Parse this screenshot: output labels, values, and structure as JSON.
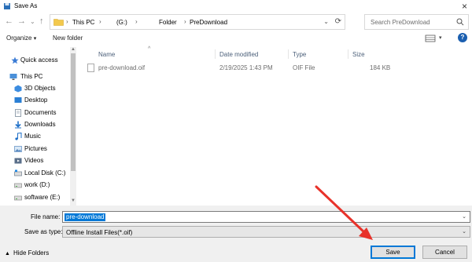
{
  "window": {
    "title": "Save As"
  },
  "address": {
    "crumbs": [
      "This PC",
      "(G:)",
      "Folder",
      "PreDownload"
    ]
  },
  "search": {
    "placeholder": "Search PreDownload"
  },
  "toolbar": {
    "organize_label": "Organize",
    "new_folder_label": "New folder",
    "help_label": "?"
  },
  "nav": {
    "items": [
      {
        "label": "Quick access",
        "icon": "star-icon",
        "color": "#3a7bd5"
      },
      {
        "label": "This PC",
        "icon": "computer-icon",
        "color": "#4a90d9"
      },
      {
        "label": "3D Objects",
        "icon": "cube-icon",
        "color": "#3c8ce0"
      },
      {
        "label": "Desktop",
        "icon": "desktop-icon",
        "color": "#2a7fd4"
      },
      {
        "label": "Documents",
        "icon": "document-icon",
        "color": "#7a8a9a"
      },
      {
        "label": "Downloads",
        "icon": "download-icon",
        "color": "#1e6fc8"
      },
      {
        "label": "Music",
        "icon": "music-icon",
        "color": "#1e6fc8"
      },
      {
        "label": "Pictures",
        "icon": "picture-icon",
        "color": "#5a8ac0"
      },
      {
        "label": "Videos",
        "icon": "video-icon",
        "color": "#5a6f8a"
      },
      {
        "label": "Local Disk (C:)",
        "icon": "drive-icon",
        "color": "#6f7f8f"
      },
      {
        "label": "work (D:)",
        "icon": "drive-icon",
        "color": "#8a8a8a"
      },
      {
        "label": "software (E:)",
        "icon": "drive-icon",
        "color": "#8a8a8a"
      }
    ]
  },
  "files": {
    "columns": [
      "Name",
      "Date modified",
      "Type",
      "Size"
    ],
    "rows": [
      {
        "name": "pre-download.oif",
        "date": "2/19/2025 1:43 PM",
        "type": "OIF File",
        "size": "184 KB"
      }
    ]
  },
  "form": {
    "filename_label": "File name:",
    "filename_value": "pre-download",
    "savetype_label": "Save as type:",
    "savetype_value": "Offline Install Files(*.oif)"
  },
  "footer": {
    "hide_folders_label": "Hide Folders",
    "save_label": "Save",
    "cancel_label": "Cancel"
  },
  "colors": {
    "accent": "#0078d7",
    "annotation_arrow": "#e8322a",
    "column_header": "#4c607a"
  }
}
